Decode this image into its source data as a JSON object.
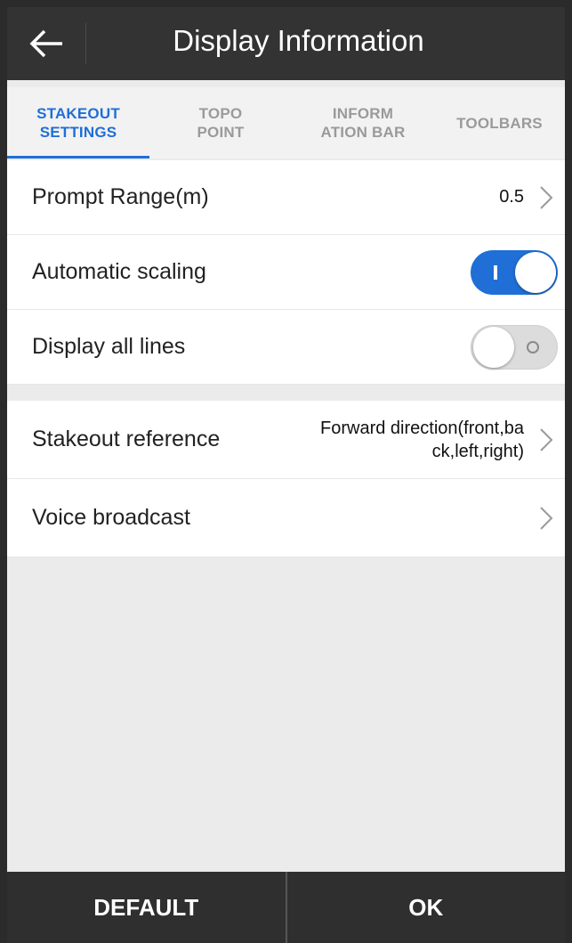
{
  "header": {
    "title": "Display Information",
    "back_icon": "arrow-left-icon"
  },
  "tabs": [
    {
      "label": "STAKEOUT\nSETTINGS",
      "active": true
    },
    {
      "label": "TOPO\nPOINT",
      "active": false
    },
    {
      "label": "INFORM\nATION BAR",
      "active": false
    },
    {
      "label": "TOOLBARS",
      "active": false
    }
  ],
  "settings": {
    "prompt_range": {
      "label": "Prompt Range(m)",
      "value": "0.5"
    },
    "automatic_scaling": {
      "label": "Automatic scaling",
      "enabled": true
    },
    "display_all_lines": {
      "label": "Display all lines",
      "enabled": false
    },
    "stakeout_reference": {
      "label": "Stakeout reference",
      "value": "Forward direction(front,back,left,right)",
      "value_line1": "Forward direction(front,ba",
      "value_line2": "ck,left,right)"
    },
    "voice_broadcast": {
      "label": "Voice broadcast"
    }
  },
  "footer": {
    "default_label": "DEFAULT",
    "ok_label": "OK"
  },
  "colors": {
    "accent": "#1f6fd6",
    "header_bg": "#333333",
    "footer_bg": "#2f2f2f"
  }
}
